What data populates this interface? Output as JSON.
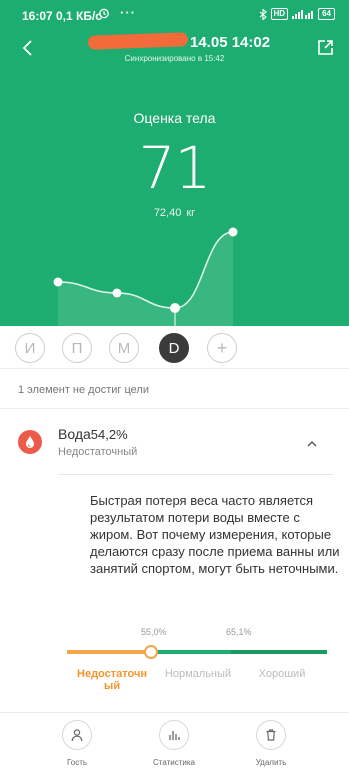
{
  "status_bar": {
    "time": "16:07",
    "speed": "0,1 КБ/с",
    "dots": "···",
    "network_badge": "4G",
    "battery": "64"
  },
  "header": {
    "date": "14.05 14:02",
    "sync": "Синхронизировано в 15:42"
  },
  "hero": {
    "label": "Оценка тела",
    "score": "71",
    "weight_value": "72,40",
    "weight_unit": "кг",
    "trend_values": [
      38,
      27,
      12,
      88
    ],
    "trend_color": "#ffffff"
  },
  "days": [
    {
      "label": "И",
      "active": false
    },
    {
      "label": "П",
      "active": false
    },
    {
      "label": "М",
      "active": false
    },
    {
      "label": "D",
      "active": true
    },
    {
      "label": "+",
      "active": false
    }
  ],
  "notice": "1 элемент не достиг цели",
  "metric": {
    "name": "Вода",
    "value": "54,2%",
    "status": "Недостаточный",
    "icon": "water-drop-icon",
    "icon_color": "#ec5a4a",
    "description": "Быстрая потеря веса часто является результатом потери воды вместе с жиром. Вот почему измерения, которые делаются сразу после приема ванны или занятий спортом, могут быть неточными."
  },
  "scale": {
    "thresholds": [
      "55,0%",
      "65,1%"
    ],
    "levels": [
      "Недостаточный",
      "Нормальный",
      "Хороший"
    ],
    "level_display": [
      "Недостаточн ый",
      "Нормальный",
      "Хороший"
    ],
    "active_level": 0,
    "colors": {
      "low": "#f3a547",
      "normal": "#1ead70",
      "good": "#1d9a5f"
    }
  },
  "bottom_nav": [
    {
      "label": "Гость",
      "icon": "person-icon"
    },
    {
      "label": "Статистика",
      "icon": "bar-chart-icon"
    },
    {
      "label": "Удалить",
      "icon": "trash-icon"
    }
  ],
  "theme": {
    "accent": "#1ead70",
    "warning": "#f2952b"
  }
}
